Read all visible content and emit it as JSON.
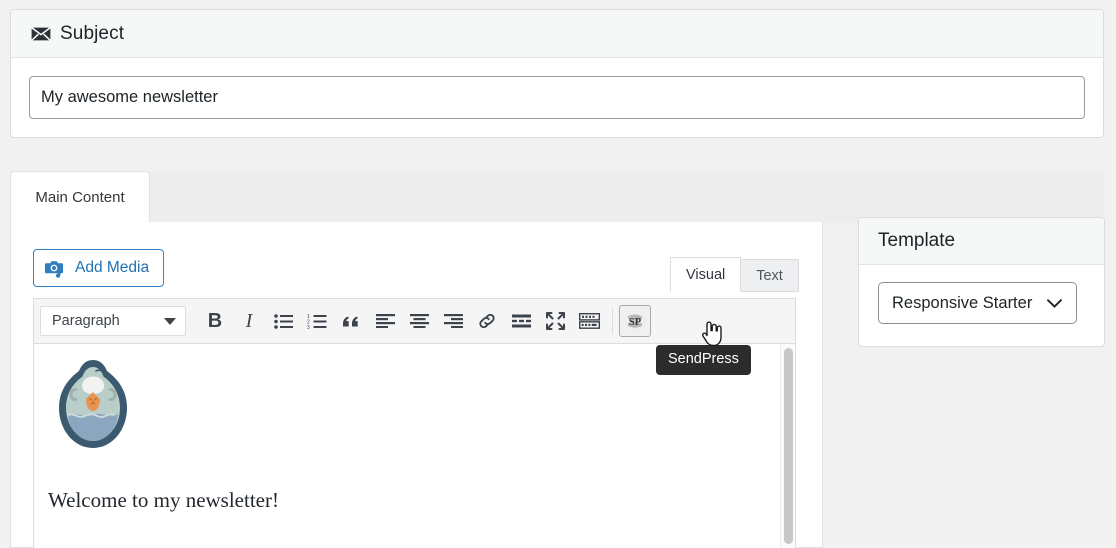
{
  "subject": {
    "icon": "envelope-icon",
    "title": "Subject",
    "value": "My awesome newsletter",
    "placeholder": "Subject"
  },
  "tabs": [
    {
      "label": "Main Content",
      "active": true
    }
  ],
  "editor": {
    "add_media_label": "Add Media",
    "add_media_icon": "media-camera-music-icon",
    "mode_tabs": [
      {
        "label": "Visual",
        "active": true
      },
      {
        "label": "Text",
        "active": false
      }
    ],
    "toolbar": {
      "format_value": "Paragraph",
      "buttons": [
        {
          "name": "bold",
          "glyph": "B"
        },
        {
          "name": "italic",
          "glyph": "I"
        },
        {
          "name": "bulleted-list",
          "glyph": ""
        },
        {
          "name": "numbered-list",
          "glyph": ""
        },
        {
          "name": "blockquote",
          "glyph": "“"
        },
        {
          "name": "align-left",
          "glyph": ""
        },
        {
          "name": "align-center",
          "glyph": ""
        },
        {
          "name": "align-right",
          "glyph": ""
        },
        {
          "name": "insert-link",
          "glyph": ""
        },
        {
          "name": "insert-read-more",
          "glyph": ""
        },
        {
          "name": "distraction-free",
          "glyph": ""
        },
        {
          "name": "toolbar-toggle",
          "glyph": ""
        },
        {
          "name": "sendpress",
          "glyph": "SP"
        }
      ]
    },
    "content": {
      "logo_alt": "sendpress-bird-logo",
      "body_text": "Welcome to my newsletter!"
    },
    "tooltip": "SendPress"
  },
  "template": {
    "title": "Template",
    "selected": "Responsive Starter"
  },
  "colors": {
    "page_bg": "#f1f1f1",
    "panel_bg": "#ffffff",
    "header_bg": "#f6f7f7",
    "accent_blue": "#2271b1",
    "border": "#dcdcde",
    "tooltip_bg": "#2c2c2c",
    "bird_outline": "#3b5a70",
    "bird_body": "#b9cdc9",
    "bird_chest": "#8ba6bf",
    "bird_beak": "#e8954e"
  }
}
